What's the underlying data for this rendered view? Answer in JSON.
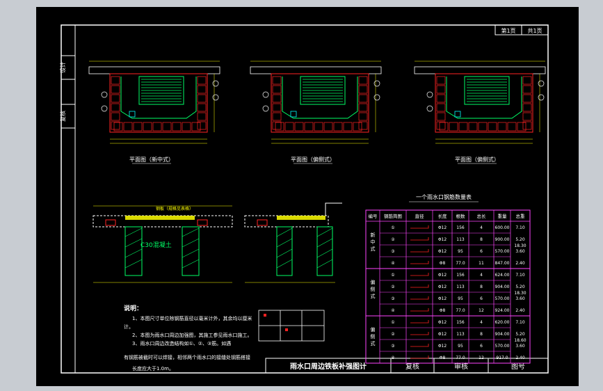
{
  "title_block": {
    "page_label": "第1页",
    "total_label": "共1页",
    "drawing_title": "雨水口周边铁板补强图计",
    "review_label": "复核",
    "audit_label": "审核",
    "figno_label": "图号",
    "side_label_1": "设计",
    "side_label_2": "复核"
  },
  "plans": [
    {
      "label": "平面图（新中式）"
    },
    {
      "label": "平面图（偏侧式）"
    },
    {
      "label": "平面图（偏侧式）"
    }
  ],
  "section": {
    "concrete_label": "C30混凝土",
    "notes_1": "钢板（规格见表格）"
  },
  "table": {
    "title": "一个雨水口钢筋数量表",
    "headers": [
      "编号",
      "钢筋简图",
      "直径",
      "长度",
      "根数",
      "总长",
      "重量",
      "总重"
    ],
    "groups": [
      {
        "name": "新中式",
        "total": "18.30",
        "rows": [
          {
            "no": "①",
            "dia": "Φ12",
            "len": "156",
            "cnt": "4",
            "tot": "600.00",
            "w": "7.10"
          },
          {
            "no": "②",
            "dia": "Φ12",
            "len": "113",
            "cnt": "8",
            "tot": "900.00",
            "w": "5.20"
          },
          {
            "no": "③",
            "dia": "Φ12",
            "len": "95",
            "cnt": "6",
            "tot": "570.00",
            "w": "3.60"
          },
          {
            "no": "④",
            "dia": "Φ8",
            "len": "77.0",
            "cnt": "11",
            "tot": "847.00",
            "w": "2.40"
          }
        ]
      },
      {
        "name": "偏侧式",
        "total": "18.30",
        "rows": [
          {
            "no": "①",
            "dia": "Φ12",
            "len": "156",
            "cnt": "4",
            "tot": "624.00",
            "w": "7.10"
          },
          {
            "no": "②",
            "dia": "Φ12",
            "len": "113",
            "cnt": "8",
            "tot": "904.00",
            "w": "5.20"
          },
          {
            "no": "③",
            "dia": "Φ12",
            "len": "95",
            "cnt": "6",
            "tot": "570.00",
            "w": "3.60"
          },
          {
            "no": "④",
            "dia": "Φ8",
            "len": "77.0",
            "cnt": "12",
            "tot": "924.00",
            "w": "2.40"
          }
        ]
      },
      {
        "name": "偏侧式",
        "total": "18.60",
        "rows": [
          {
            "no": "①",
            "dia": "Φ12",
            "len": "156",
            "cnt": "4",
            "tot": "620.00",
            "w": "7.10"
          },
          {
            "no": "②",
            "dia": "Φ12",
            "len": "113",
            "cnt": "8",
            "tot": "904.00",
            "w": "5.20"
          },
          {
            "no": "③",
            "dia": "Φ12",
            "len": "95",
            "cnt": "6",
            "tot": "570.00",
            "w": "3.60"
          },
          {
            "no": "④",
            "dia": "Φ8",
            "len": "77.0",
            "cnt": "12",
            "tot": "917.0",
            "w": "2.40"
          }
        ]
      }
    ]
  },
  "notes": {
    "heading": "说明：",
    "lines": [
      "1、本图尺寸单位除钢筋直径以毫米计外，其余均以厘米",
      "计。",
      "2、本图为雨水口周边加强图，其施工参见雨水口施工。",
      "3、雨水口周边改造结构如①、②、③筋。如遇",
      "有钢筋被截时可以焊接，相邻两个雨水口的接缝处钢筋搭接",
      "长度应大于1.0m。"
    ]
  },
  "colors": {
    "frame": "#ffffff",
    "structure": "#ff2222",
    "rebar": "#00ff66",
    "dimension": "#ffff00",
    "accent": "#ff44ff",
    "cyan": "#00ffff"
  }
}
